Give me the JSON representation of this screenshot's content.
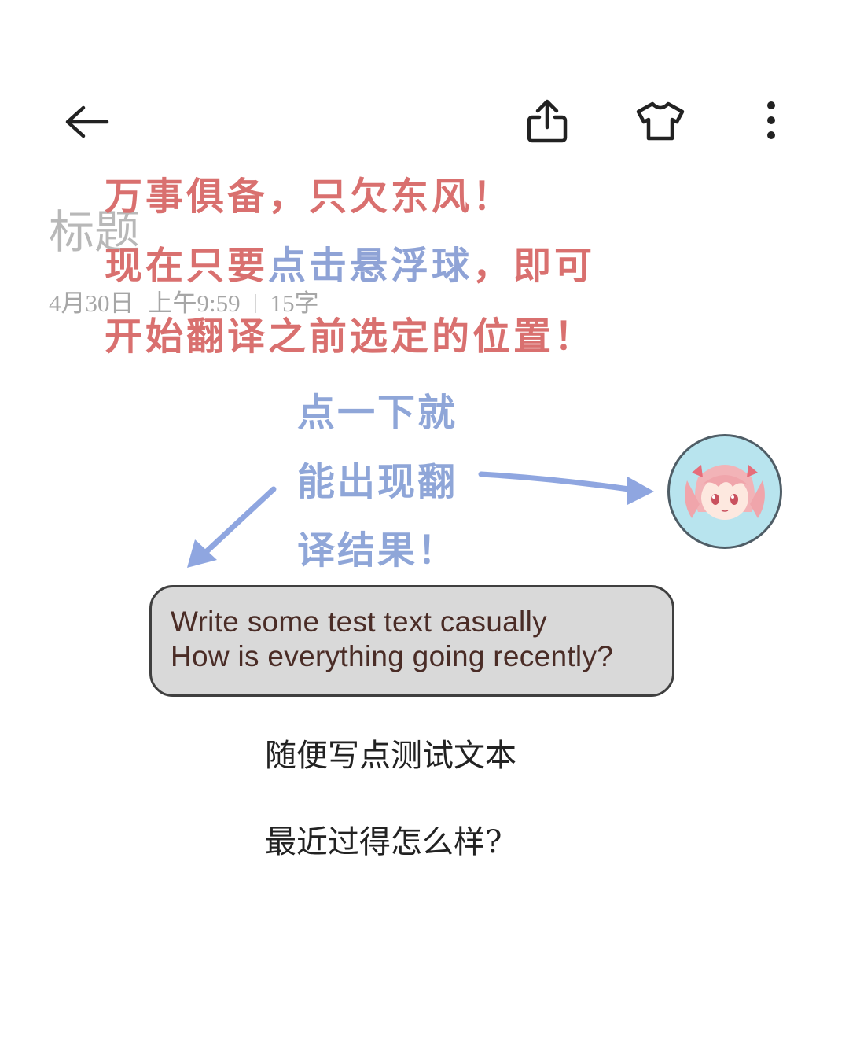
{
  "toolbar": {
    "back_icon": "arrow-left-icon",
    "share_icon": "share-icon",
    "theme_icon": "tshirt-icon",
    "more_icon": "more-vertical-icon"
  },
  "note": {
    "title_placeholder": "标题",
    "date": "4月30日",
    "time": "上午9:59",
    "word_count": "15字",
    "lines": [
      "随便写点测试文本",
      "最近过得怎么样?"
    ]
  },
  "callout": {
    "line1": "万事俱备，只欠东风！",
    "line2_a": "现在只要",
    "line2_highlight": "点击悬浮球",
    "line2_b": "，即可",
    "line3": "开始翻译之前选定的位置！"
  },
  "hint": {
    "line1": "点一下就",
    "line2": "能出现翻",
    "line3": "译结果！"
  },
  "translation": {
    "line1": "Write some test text casually",
    "line2": "How is everything going recently?"
  },
  "colors": {
    "callout": "#d9706f",
    "hint": "#8fa6d8",
    "translation_bg": "#d9d9d9",
    "translation_text": "#4a2c26",
    "float_ball_bg": "#b8e4ee"
  }
}
